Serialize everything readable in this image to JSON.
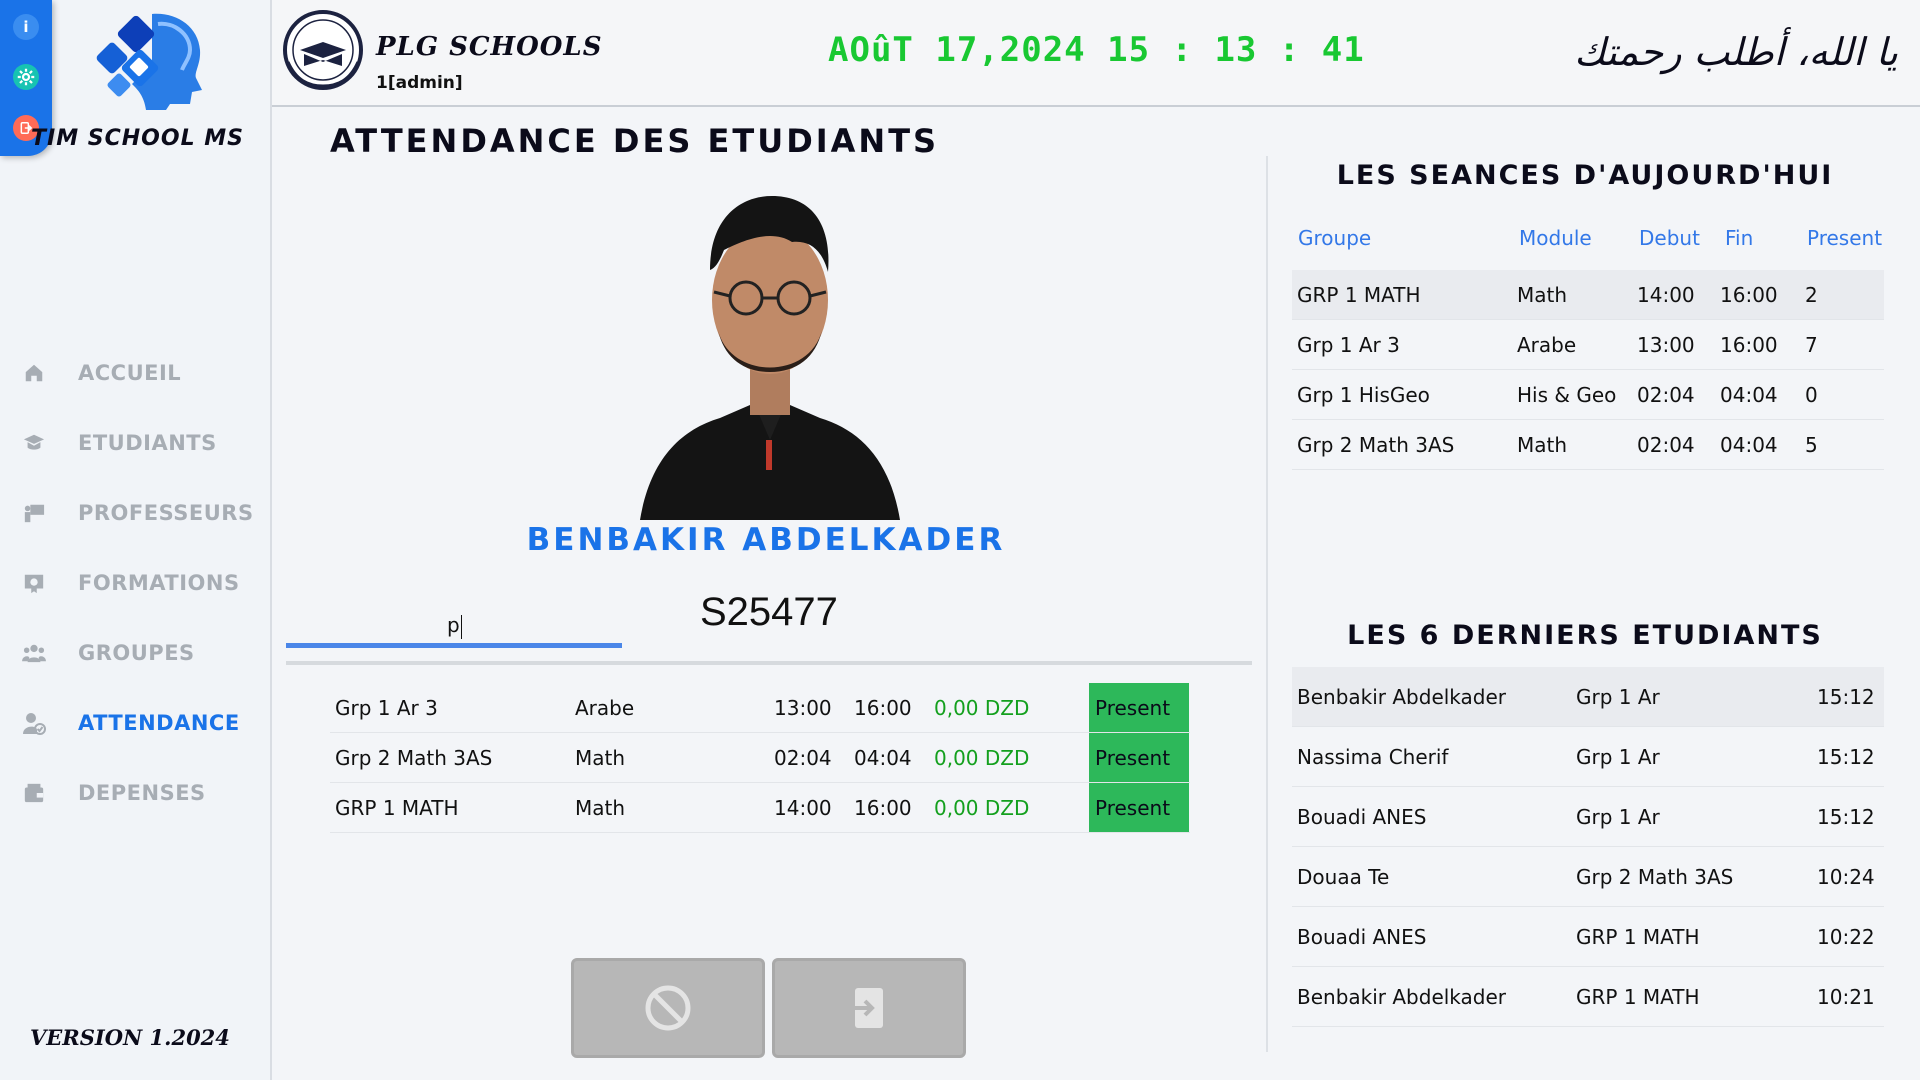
{
  "app": {
    "name": "TIM SCHOOL MS",
    "version": "VERSION 1.2024",
    "mini_icons": [
      "info-icon",
      "gear-icon",
      "logout-icon"
    ]
  },
  "header": {
    "school_name": "PLG SCHOOLS",
    "user": "1[admin]",
    "datetime": "AOûT 17,2024 15 : 13 : 41",
    "prayer": "يا الله، أطلب رحمتك"
  },
  "sidebar": {
    "items": [
      {
        "label": "ACCUEIL",
        "icon": "home-icon"
      },
      {
        "label": "ETUDIANTS",
        "icon": "graduation-cap-icon"
      },
      {
        "label": "PROFESSEURS",
        "icon": "teacher-board-icon"
      },
      {
        "label": "FORMATIONS",
        "icon": "certificate-icon"
      },
      {
        "label": "GROUPES",
        "icon": "users-icon"
      },
      {
        "label": "ATTENDANCE",
        "icon": "user-check-icon"
      },
      {
        "label": "DEPENSES",
        "icon": "wallet-icon"
      }
    ],
    "active_index": 5
  },
  "attendance": {
    "title": "ATTENDANCE DES ETUDIANTS",
    "student_name": "BENBAKIR  ABDELKADER",
    "code_input_value": "p",
    "student_id": "S25477",
    "sessions": [
      {
        "group": "Grp 1 Ar 3",
        "module": "Arabe",
        "start": "13:00",
        "end": "16:00",
        "amount": "0,00 DZD",
        "status": "Present"
      },
      {
        "group": "Grp 2 Math 3AS",
        "module": "Math",
        "start": "02:04",
        "end": "04:04",
        "amount": "0,00 DZD",
        "status": "Present"
      },
      {
        "group": "GRP 1 MATH",
        "module": "Math",
        "start": "14:00",
        "end": "16:00",
        "amount": "0,00 DZD",
        "status": "Present"
      }
    ],
    "buttons": {
      "cancel_icon": "ban-icon",
      "enter_icon": "sign-in-icon"
    }
  },
  "today_sessions": {
    "title": "LES SEANCES D'AUJOURD'HUI",
    "headers": {
      "group": "Groupe",
      "module": "Module",
      "start": "Debut",
      "end": "Fin",
      "present": "Present"
    },
    "rows": [
      {
        "group": "GRP 1 MATH",
        "module": "Math",
        "start": "14:00",
        "end": "16:00",
        "present": "2"
      },
      {
        "group": "Grp 1 Ar 3",
        "module": "Arabe",
        "start": "13:00",
        "end": "16:00",
        "present": "7"
      },
      {
        "group": "Grp 1 HisGeo",
        "module": "His & Geo",
        "start": "02:04",
        "end": "04:04",
        "present": "0"
      },
      {
        "group": "Grp 2 Math 3AS",
        "module": "Math",
        "start": "02:04",
        "end": "04:04",
        "present": "5"
      }
    ]
  },
  "last_students": {
    "title": "LES 6 DERNIERS ETUDIANTS",
    "rows": [
      {
        "name": "Benbakir Abdelkader",
        "group": "Grp 1 Ar",
        "time": "15:12"
      },
      {
        "name": "Nassima Cherif",
        "group": "Grp 1 Ar",
        "time": "15:12"
      },
      {
        "name": "Bouadi ANES",
        "group": "Grp 1 Ar",
        "time": "15:12"
      },
      {
        "name": "Douaa Te",
        "group": "Grp 2 Math 3AS",
        "time": "10:24"
      },
      {
        "name": "Bouadi ANES",
        "group": "GRP 1 MATH",
        "time": "10:22"
      },
      {
        "name": "Benbakir Abdelkader",
        "group": "GRP 1 MATH",
        "time": "10:21"
      }
    ]
  },
  "colors": {
    "accent": "#1a73e8",
    "clock": "#19c832",
    "present_badge": "#2db85a",
    "amount": "#14a01e",
    "nav_inactive": "#a7adb4"
  }
}
